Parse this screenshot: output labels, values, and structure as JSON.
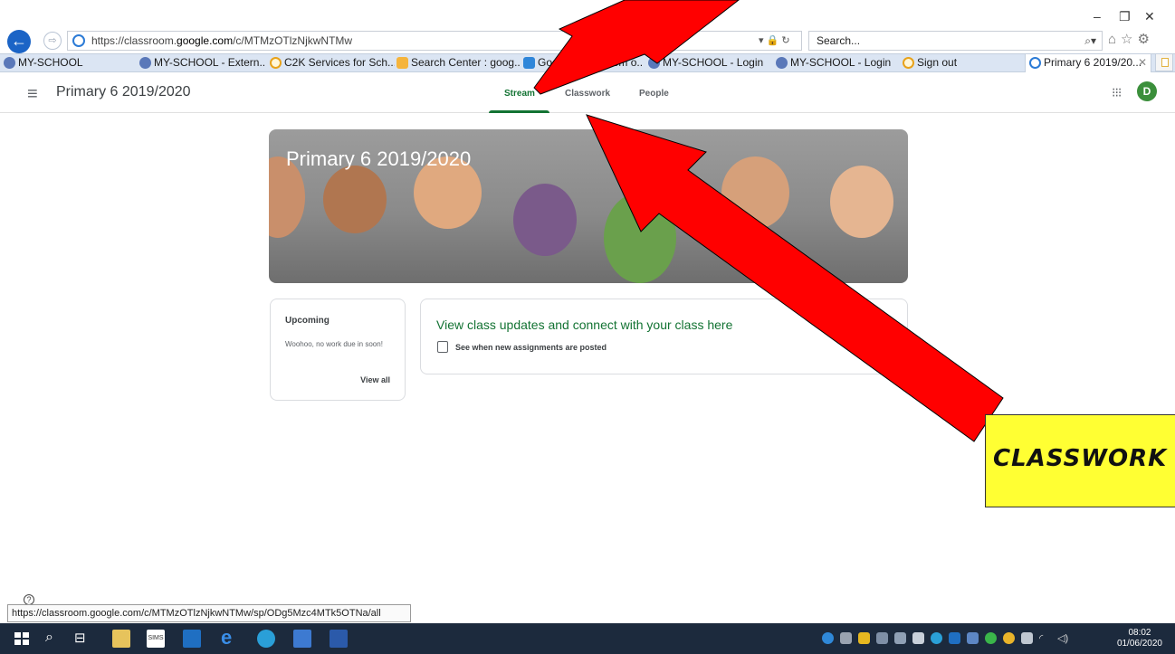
{
  "browser": {
    "url": "https://classroom.google.com/c/MTMzOTlzNjkwNTMw",
    "url_prefix": "https://classroom.",
    "url_host": "google.com",
    "url_path": "/c/MTMzOTlzNjkwNTMw",
    "search_placeholder": "Search...",
    "window_controls": {
      "minimize": "–",
      "restore": "❐",
      "close": "✕"
    },
    "favorites": [
      {
        "label": "MY-SCHOOL",
        "icon": "school-icon"
      },
      {
        "label": "MY-SCHOOL - Extern...",
        "icon": "school-icon"
      },
      {
        "label": "C2K Services for Sch...",
        "icon": "ie-icon"
      },
      {
        "label": "Search Center : goog...",
        "icon": "search-center-icon"
      },
      {
        "label": "Google Classroom o...",
        "icon": "app-store-icon"
      },
      {
        "label": "MY-SCHOOL - Login",
        "icon": "school-icon"
      },
      {
        "label": "MY-SCHOOL - Login",
        "icon": "school-icon"
      },
      {
        "label": "Sign out",
        "icon": "ie-icon"
      }
    ],
    "active_tab": {
      "label": "Primary 6 2019/20...",
      "close": "✕"
    },
    "status_url": "https://classroom.google.com/c/MTMzOTlzNjkwNTMw/sp/ODg5Mzc4MTk5OTNa/all"
  },
  "classroom": {
    "class_name": "Primary 6 2019/2020",
    "tabs": [
      {
        "label": "Stream",
        "active": true
      },
      {
        "label": "Classwork",
        "active": false
      },
      {
        "label": "People",
        "active": false
      }
    ],
    "avatar_initial": "D",
    "banner_title": "Primary 6 2019/2020",
    "upcoming": {
      "title": "Upcoming",
      "text": "Woohoo, no work due in soon!",
      "view_all": "View all"
    },
    "stream_card": {
      "title": "View class updates and connect with your class here",
      "subtitle": "See when new assignments are posted"
    },
    "help": "?"
  },
  "annotation": {
    "callout_text": "CLASSWORK",
    "arrow_color": "#ff0000",
    "callout_color": "#ffff33"
  },
  "taskbar": {
    "time": "08:02",
    "date": "01/06/2020"
  },
  "colors": {
    "accent_green": "#137333",
    "ie_blue": "#1b64c6"
  }
}
